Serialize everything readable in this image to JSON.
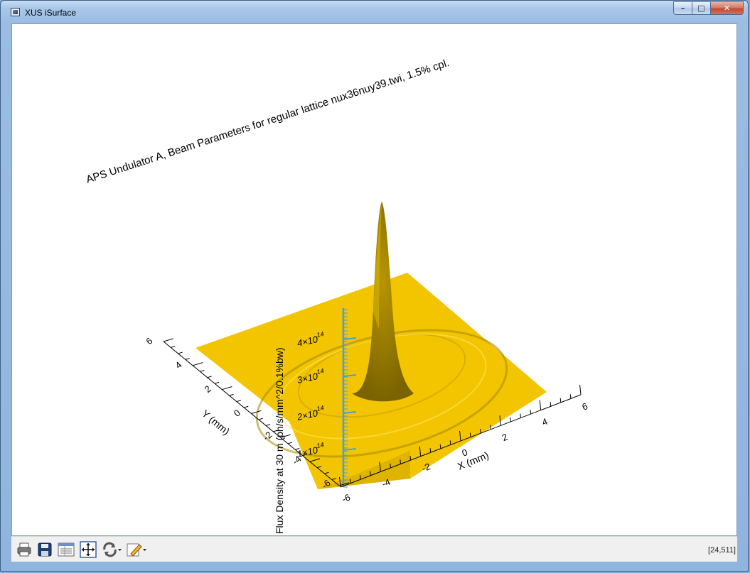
{
  "window": {
    "title": "XUS iSurface",
    "controls": {
      "minimize": "–",
      "maximize": "□",
      "close": "✕"
    }
  },
  "plot": {
    "title": "APS Undulator A, Beam Parameters for regular lattice nux36nuy39.twi, 1.5% cpl.",
    "x_axis": {
      "label": "X (mm)",
      "ticks": [
        "-6",
        "-4",
        "-2",
        "0",
        "2",
        "4",
        "6"
      ]
    },
    "y_axis": {
      "label": "Y (mm)",
      "ticks": [
        "-6",
        "-4",
        "-2",
        "0",
        "2",
        "4",
        "6"
      ]
    },
    "z_axis": {
      "label": "Flux Density at 30 m (ph/s/mm^2/0.1%bw)",
      "ticks": [
        "1",
        "2",
        "3",
        "4"
      ],
      "tick_suffix": "×10",
      "tick_exponent": "14",
      "color": "#4a9ee0"
    },
    "surface_color": "#f2c500",
    "surface_shade": "#9a7e00"
  },
  "chart_data": {
    "type": "surface",
    "title": "APS Undulator A, Beam Parameters for regular lattice nux36nuy39.twi, 1.5% cpl.",
    "xlabel": "X (mm)",
    "ylabel": "Y (mm)",
    "zlabel": "Flux Density at 30 m (ph/s/mm^2/0.1%bw)",
    "xlim": [
      -6,
      6
    ],
    "ylim": [
      -6,
      6
    ],
    "zticks": [
      "1×10^14",
      "2×10^14",
      "3×10^14",
      "4×10^14"
    ],
    "peak": {
      "x": 0,
      "y": 0,
      "z": 550000000000000.0
    }
  },
  "toolbar": {
    "items": [
      {
        "name": "print-icon"
      },
      {
        "name": "save-icon"
      },
      {
        "name": "properties-icon"
      },
      {
        "name": "resize-icon"
      },
      {
        "name": "rotate-icon"
      },
      {
        "name": "annotate-icon"
      }
    ],
    "status": "[24,511]"
  }
}
